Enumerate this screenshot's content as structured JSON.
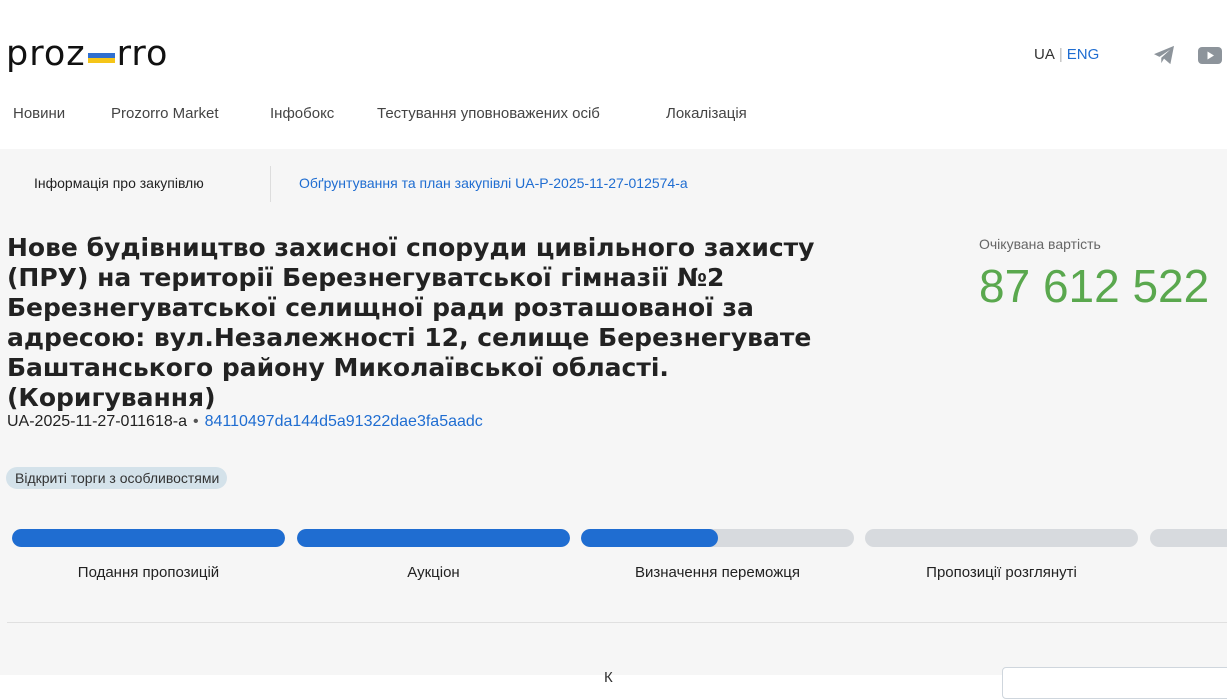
{
  "header": {
    "logo_left": "proz",
    "logo_right": "rro",
    "lang_ua": "UA",
    "lang_separator": "|",
    "lang_eng": "ENG",
    "icons": [
      "telegram-icon",
      "youtube-icon"
    ]
  },
  "nav": {
    "items": [
      "Новини",
      "Prozorro Market",
      "Інфобокс",
      "Тестування уповноважених осіб",
      "Локалізація"
    ]
  },
  "tabs": {
    "info": "Інформація про закупівлю",
    "plan": "Обґрунтування та план закупівлі UA-P-2025-11-27-012574-a"
  },
  "tender": {
    "title": "Нове будівництво захисної споруди цивільного захисту (ПРУ) на території Березнегуватської гімназії №2 Березнегу­ватської селищної ради розташованої за адресою: вул.Незалежності 12, селище Березнегувате Баштанського району Миколаївської області. (Коригування)",
    "id": "UA-2025-11-27-011618-a",
    "id_separator": "•",
    "hash": "84110497da144d5a91322dae3fa5aadc",
    "procedure": "Відкриті торги з особливостями",
    "value_label": "Очікувана вартість",
    "value_amount": "87 612 522"
  },
  "steps": [
    {
      "label": "Подання пропозицій",
      "progress": 1.0
    },
    {
      "label": "Аукціон",
      "progress": 1.0
    },
    {
      "label": "Визначення переможця",
      "progress": 0.5
    },
    {
      "label": "Пропозиції розглянуті",
      "progress": 0.0
    },
    {
      "label": "",
      "progress": 0.0
    }
  ],
  "colors": {
    "accent": "#1f6dd1",
    "value_green": "#5aa84e",
    "badge_bg": "#d4e2ea",
    "track": "#d7dade",
    "flag_blue": "#2f6fd0",
    "flag_yellow": "#f5c518"
  },
  "bottom": {
    "text": "К"
  }
}
